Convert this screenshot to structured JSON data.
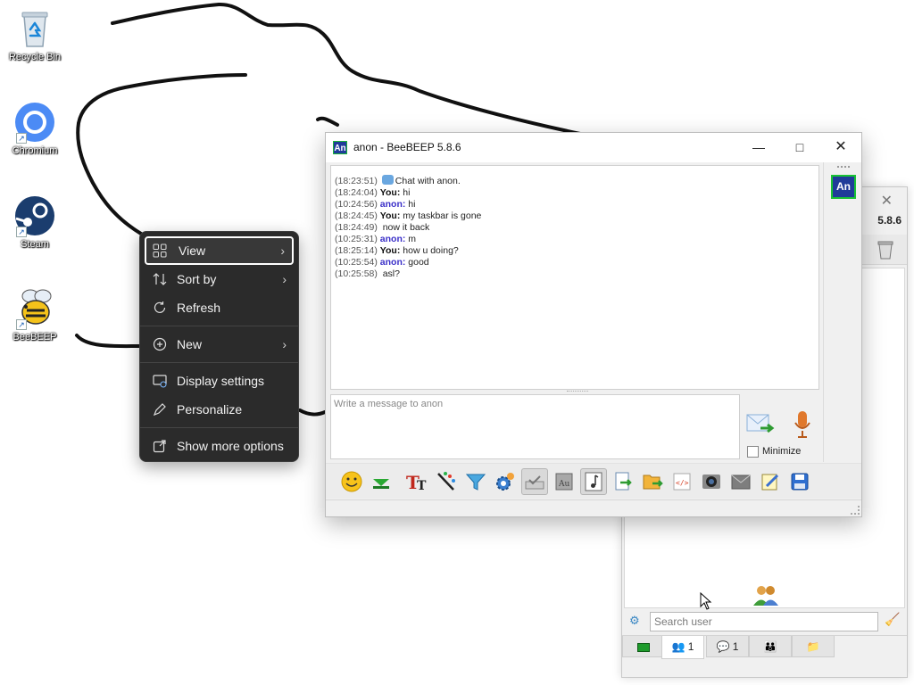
{
  "desktop": {
    "icons": [
      {
        "label": "Recycle Bin",
        "icon": "recycle-bin-icon"
      },
      {
        "label": "Chromium",
        "icon": "chromium-icon"
      },
      {
        "label": "Steam",
        "icon": "steam-icon"
      },
      {
        "label": "BeeBEEP",
        "icon": "beebeep-icon"
      }
    ]
  },
  "context_menu": {
    "items": [
      {
        "label": "View",
        "icon": "grid-view-icon",
        "submenu": true,
        "highlighted": true
      },
      {
        "label": "Sort by",
        "icon": "sort-icon",
        "submenu": true
      },
      {
        "label": "Refresh",
        "icon": "refresh-icon"
      },
      {
        "label": "New",
        "icon": "new-plus-icon",
        "submenu": true
      },
      {
        "label": "Display settings",
        "icon": "display-settings-icon"
      },
      {
        "label": "Personalize",
        "icon": "pen-icon"
      },
      {
        "label": "Show more options",
        "icon": "open-external-icon"
      }
    ]
  },
  "chat_window": {
    "title": "anon - BeeBEEP 5.8.6",
    "badge": "An",
    "avatar": "An",
    "messages": [
      {
        "time": "(18:23:51)",
        "who": "",
        "text": "Chat with anon.",
        "system": true
      },
      {
        "time": "(18:24:04)",
        "who": "You:",
        "text": " hi",
        "from": "you"
      },
      {
        "time": "(10:24:56)",
        "who": "anon:",
        "text": " hi",
        "from": "anon"
      },
      {
        "time": "(18:24:45)",
        "who": "You:",
        "text": " my taskbar is gone",
        "from": "you"
      },
      {
        "time": "(18:24:49)",
        "who": "",
        "text": "now it back",
        "from": "cont"
      },
      {
        "time": "(10:25:31)",
        "who": "anon:",
        "text": " m",
        "from": "anon"
      },
      {
        "time": "(18:25:14)",
        "who": "You:",
        "text": " how u doing?",
        "from": "you"
      },
      {
        "time": "(10:25:54)",
        "who": "anon:",
        "text": " good",
        "from": "anon"
      },
      {
        "time": "(10:25:58)",
        "who": "",
        "text": "asl?",
        "from": "cont"
      }
    ],
    "compose_placeholder": "Write a message to anon",
    "minimize_label": "Minimize",
    "toolbar_icons": [
      "emoticon-icon",
      "download-icon",
      "font-icon",
      "color-pen-icon",
      "filter-icon",
      "settings-gear-icon",
      "spellcheck-icon",
      "dictionary-icon",
      "music-note-icon",
      "file-send-icon",
      "folder-send-icon",
      "code-icon",
      "screenshot-icon",
      "envelope-icon",
      "edit-note-icon",
      "save-icon"
    ]
  },
  "back_window": {
    "version": "5.8.6",
    "search_placeholder": "Search user",
    "tabs": [
      {
        "icon": "home-icon",
        "count": ""
      },
      {
        "icon": "users-icon",
        "count": "1"
      },
      {
        "icon": "chats-icon",
        "count": "1"
      },
      {
        "icon": "groups-icon",
        "count": ""
      },
      {
        "icon": "files-icon",
        "count": ""
      }
    ]
  },
  "colors": {
    "menu_bg": "#2b2b2b",
    "anon_name": "#3a2fc8",
    "avatar_bg": "#1f3b99",
    "avatar_border": "#18c234"
  }
}
